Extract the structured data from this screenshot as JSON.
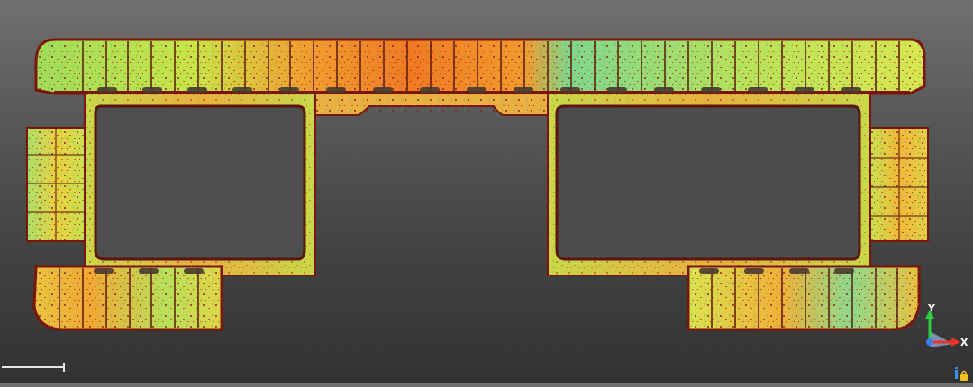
{
  "viewer": {
    "background_top": "#707070",
    "background_bottom": "#323232"
  },
  "axes": {
    "y_label": "Y",
    "x_label": "X",
    "y_color": "#2ecc40",
    "x_color": "#e8322a",
    "z_color": "#3a7ff0"
  },
  "colormap": {
    "low": "#66d9a0",
    "mid": "#d9e84a",
    "high": "#f06a1e",
    "edge": "#8b1a10"
  },
  "icons": {
    "scale": "scale-bar-icon",
    "axes": "axis-gizmo-icon",
    "info": "info-lock-icon"
  }
}
